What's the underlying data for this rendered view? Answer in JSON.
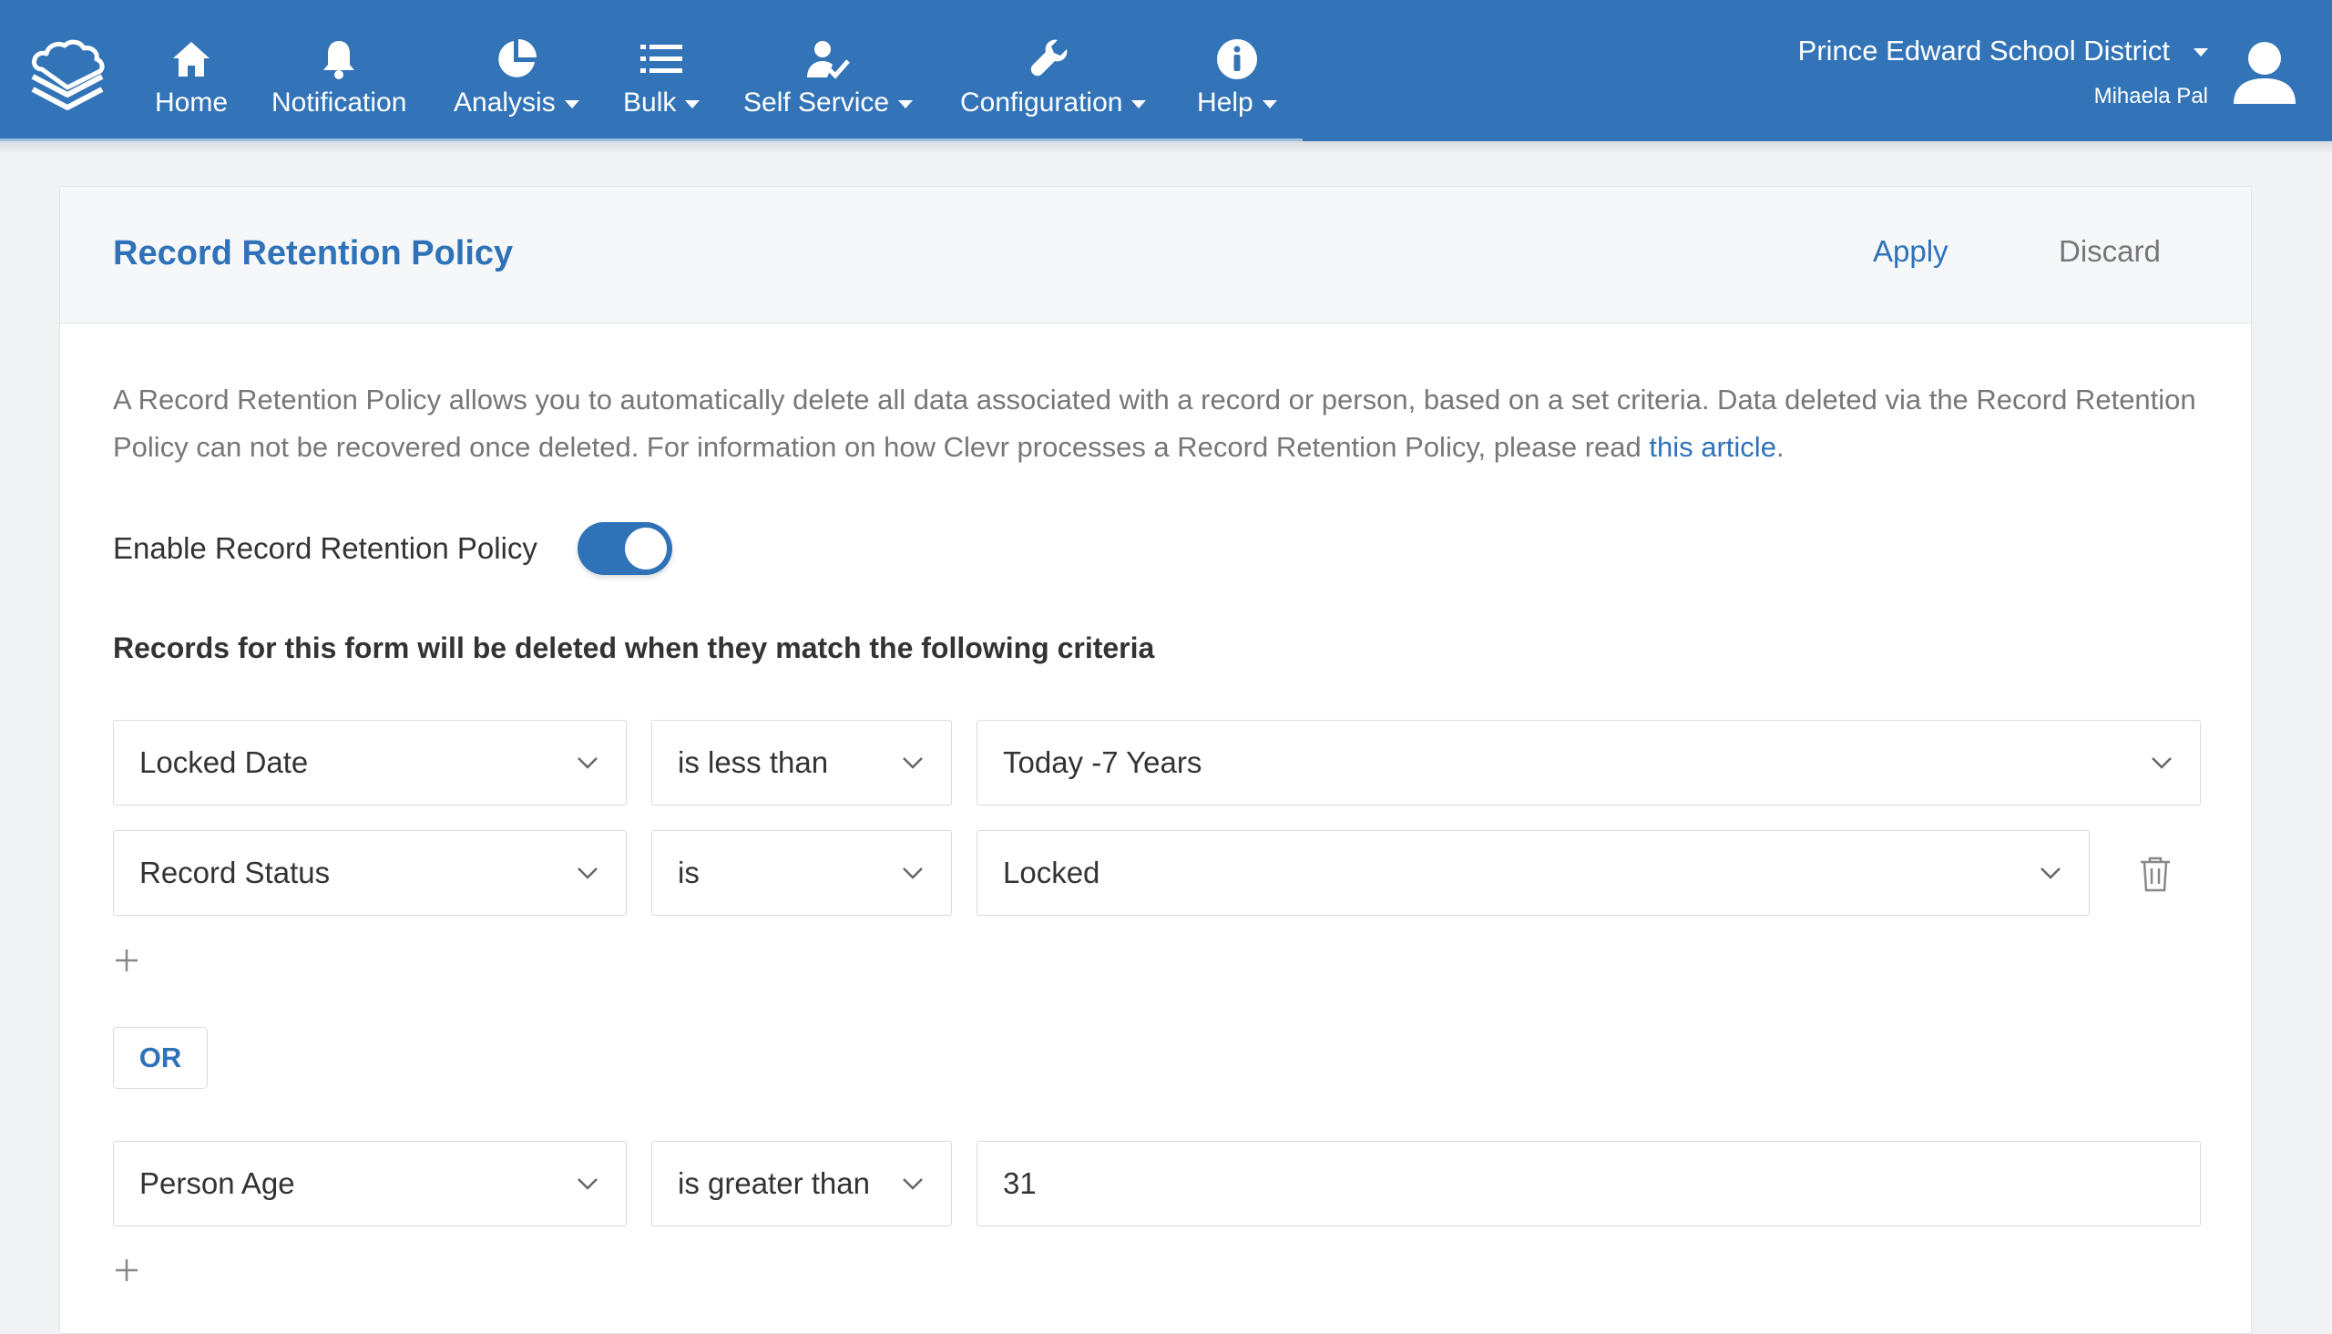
{
  "nav": {
    "items": [
      {
        "label": "Home",
        "icon": "home-icon",
        "dropdown": false
      },
      {
        "label": "Notification",
        "icon": "bell-icon",
        "dropdown": false
      },
      {
        "label": "Analysis",
        "icon": "pie-chart-icon",
        "dropdown": true
      },
      {
        "label": "Bulk",
        "icon": "list-icon",
        "dropdown": true
      },
      {
        "label": "Self Service",
        "icon": "user-check-icon",
        "dropdown": true
      },
      {
        "label": "Configuration",
        "icon": "wrench-icon",
        "dropdown": true
      },
      {
        "label": "Help",
        "icon": "info-icon",
        "dropdown": true
      }
    ],
    "district": "Prince Edward School District",
    "user": "Mihaela Pal"
  },
  "page": {
    "title": "Record Retention Policy",
    "apply": "Apply",
    "discard": "Discard",
    "description_text": "A Record Retention Policy allows you to automatically delete all data associated with a record or person, based on a set criteria. Data deleted via the Record Retention Policy can not be recovered once deleted. For information on how Clevr processes a Record Retention Policy, please read ",
    "description_link": "this article",
    "description_end": ".",
    "toggle_label": "Enable Record Retention Policy",
    "toggle_on": true,
    "criteria_heading": "Records for this form will be deleted when they match the following criteria",
    "or_label": "OR"
  },
  "criteria": {
    "row1": {
      "field": "Locked Date",
      "operator": "is less than",
      "value": "Today -7 Years"
    },
    "row2": {
      "field": "Record Status",
      "operator": "is",
      "value": "Locked"
    },
    "row3": {
      "field": "Person Age",
      "operator": "is greater than",
      "value": "31"
    }
  },
  "colors": {
    "nav_bg": "#3374b8",
    "accent": "#2f72b8"
  }
}
